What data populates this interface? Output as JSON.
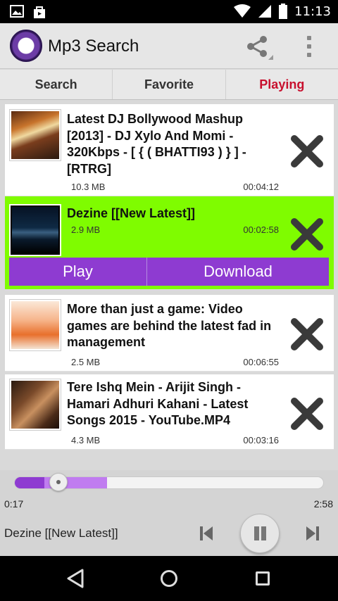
{
  "status_bar": {
    "time": "11:13",
    "icons": [
      "image-icon",
      "shopping-bag-icon",
      "wifi-icon",
      "signal-icon",
      "battery-icon"
    ]
  },
  "app_bar": {
    "title": "Mp3 Search",
    "icons": [
      "app-logo-icon",
      "share-icon",
      "overflow-menu-icon"
    ]
  },
  "tabs": [
    {
      "label": "Search",
      "active": false
    },
    {
      "label": "Favorite",
      "active": false
    },
    {
      "label": "Playing",
      "active": true
    }
  ],
  "tracks": [
    {
      "title": "Latest DJ Bollywood Mashup [2013] - DJ Xylo And Momi - 320Kbps - [ { ( BHATTI93 ) } ] - [RTRG]",
      "size": "10.3 MB",
      "duration": "00:04:12"
    },
    {
      "title": "Dezine [[New Latest]]",
      "size": "2.9 MB",
      "duration": "00:02:58",
      "selected": true,
      "actions": {
        "play": "Play",
        "download": "Download"
      }
    },
    {
      "title": "More than just a game: Video games are behind the latest fad in management",
      "size": "2.5 MB",
      "duration": "00:06:55"
    },
    {
      "title": "Tere Ishq Mein - Arijit Singh - Hamari Adhuri Kahani - Latest Songs 2015 - YouTube.MP4",
      "size": "4.3 MB",
      "duration": "00:03:16"
    }
  ],
  "player": {
    "current_time": "0:17",
    "total_time": "2:58",
    "now_playing": "Dezine [[New Latest]]",
    "played_fraction": 0.095,
    "buffered_fraction": 0.3
  },
  "colors": {
    "accent": "#8e3bd1",
    "selected_row": "#7ffc00",
    "active_tab": "#c8102e",
    "delete_icon": "#333333"
  }
}
